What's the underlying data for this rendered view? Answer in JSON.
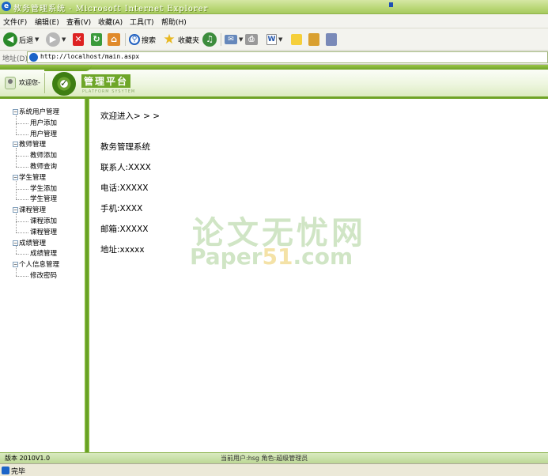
{
  "window": {
    "title": "教务管理系统 - Microsoft Internet Explorer"
  },
  "menu": [
    "文件(F)",
    "编辑(E)",
    "查看(V)",
    "收藏(A)",
    "工具(T)",
    "帮助(H)"
  ],
  "toolbar": {
    "back_label": "后退",
    "search_label": "搜索",
    "favorites_label": "收藏夹"
  },
  "address": {
    "label": "地址(D)",
    "url": "http://localhost/main.aspx"
  },
  "header": {
    "welcome": "欢迎您-",
    "title": "管理平台",
    "subtitle": "PLATFORM SYSYTEM"
  },
  "tree": [
    {
      "label": "系统用户管理",
      "children": [
        "用户添加",
        "用户管理"
      ]
    },
    {
      "label": "教师管理",
      "children": [
        "教师添加",
        "教师查询"
      ]
    },
    {
      "label": "学生管理",
      "children": [
        "学生添加",
        "学生管理"
      ]
    },
    {
      "label": "课程管理",
      "children": [
        "课程添加",
        "课程管理"
      ]
    },
    {
      "label": "成绩管理",
      "children": [
        "成绩管理"
      ]
    },
    {
      "label": "个人信息管理",
      "children": [
        "修改密码"
      ]
    }
  ],
  "main": {
    "welcome": "欢迎进入> > >",
    "system_name": "教务管理系统",
    "contact": "联系人:XXXX",
    "phone": "电话:XXXXX",
    "mobile": "手机:XXXX",
    "email": "邮箱:XXXXX",
    "address": "地址:xxxxx"
  },
  "watermark": {
    "line1": "论文无忧网",
    "line2_a": "Paper",
    "line2_b": "51",
    "line2_c": ".com"
  },
  "footer": {
    "version": "版本 2010V1.0",
    "user_info": "当前用户:hsg 角色:超级管理员"
  },
  "status": {
    "text": "完毕"
  },
  "colors": {
    "accent": "#6fa327",
    "titlebar": "#b9d777"
  }
}
